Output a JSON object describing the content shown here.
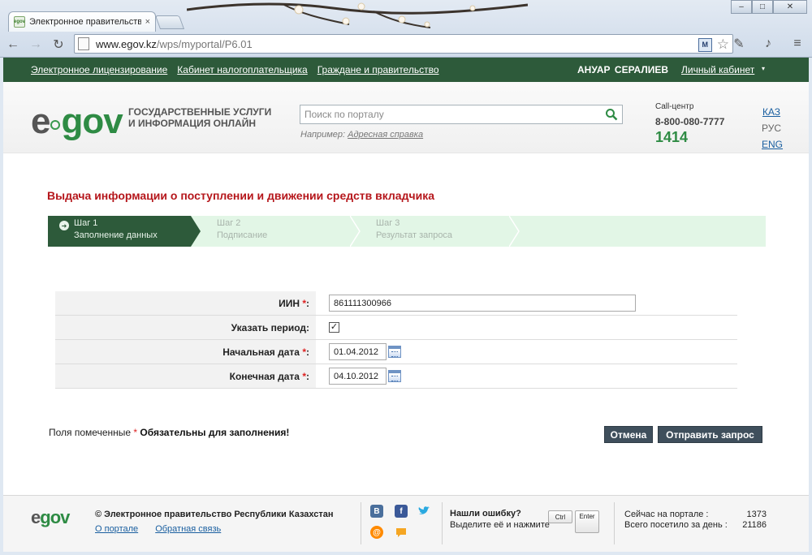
{
  "browser": {
    "tab_title": "Электронное правительств",
    "tab_close": "×",
    "url_host": "www.egov.kz",
    "url_path": "/wps/myportal/P6.01",
    "nav_back": "←",
    "nav_forward": "→",
    "nav_reload": "↻",
    "win_minimize": "–",
    "win_maximize": "□",
    "win_close": "✕"
  },
  "topnav": {
    "links": [
      "Электронное лицензирование",
      "Кабинет налогоплательщика",
      "Граждане и правительство"
    ],
    "user_name": "АНУАР СЕРАЛИЕВ",
    "cabinet": "Личный кабинет",
    "caret": "▾"
  },
  "header": {
    "logo_e": "e",
    "logo_gov": "gov",
    "slogan": "ГОСУДАРСТВЕННЫЕ УСЛУГИ И ИНФОРМАЦИЯ ОНЛАЙН",
    "search_placeholder": "Поиск по порталу",
    "hint_prefix": "Например: ",
    "hint_link": "Адресная справка",
    "callcenter_label": "Call-центр",
    "callcenter_phone": "8-800-080-7777",
    "callcenter_short": "1414",
    "lang_kaz": "КАЗ",
    "lang_rus": "РУС",
    "lang_eng": "ENG"
  },
  "main": {
    "title": "Выдача информации о поступлении и движении средств вкладчика",
    "steps": [
      {
        "num": "Шаг 1",
        "name": "Заполнение данных"
      },
      {
        "num": "Шаг 2",
        "name": "Подписание"
      },
      {
        "num": "Шаг 3",
        "name": "Результат запроса"
      }
    ],
    "form": {
      "iin_label": "ИИН",
      "iin_value": "861111300966",
      "period_label": "Указать период:",
      "period_checked": "✓",
      "start_label": "Начальная дата",
      "start_value": "01.04.2012",
      "end_label": "Конечная дата",
      "end_value": "04.10.2012",
      "req_mark": "*",
      "colon": ":"
    },
    "required_note_prefix": "Поля помеченные ",
    "required_note_suffix": "Обязательны для заполнения!",
    "cancel_label": "Отмена",
    "submit_label": "Отправить запрос"
  },
  "footer": {
    "logo_e": "e",
    "logo_gov": "gov",
    "copyright": "© Электронное правительство Республики Казахстан",
    "about_link": "О портале",
    "feedback_link": "Обратная связь",
    "bug_title": "Нашли ошибку?",
    "bug_sub": "Выделите её и нажмите",
    "key_ctrl": "Ctrl",
    "key_enter": "Enter",
    "online_label": "Сейчас на портале :",
    "online_value": "1373",
    "visits_label": "Всего посетило за день :",
    "visits_value": "21186",
    "social": [
      "B",
      "f",
      "@"
    ]
  },
  "colors": {
    "brand_green": "#2d5a3a",
    "logo_green": "#2e8b44",
    "title_red": "#b5161b"
  }
}
